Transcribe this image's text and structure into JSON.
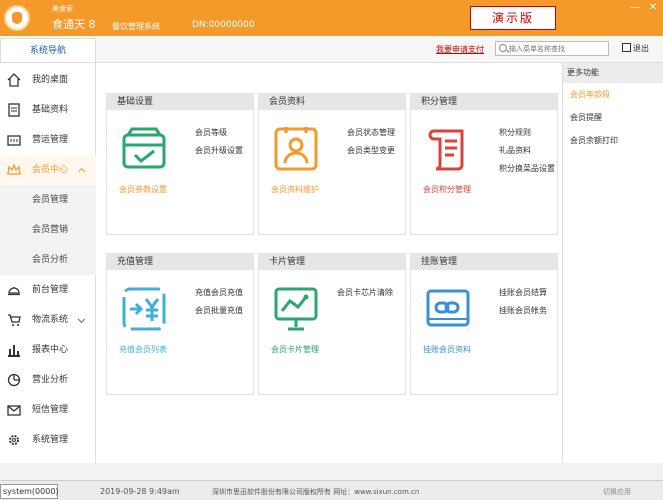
{
  "titlebar": {
    "brand_small": "美食家",
    "brand_big": "食通天 8",
    "system_name": "餐饮管理系统",
    "dn": "DN:00000000",
    "demo_badge": "演示版",
    "minimize": "—",
    "close": "✕"
  },
  "header": {
    "nav_title": "系统导航",
    "apply_link": "我要申请支付",
    "search_placeholder": "输入菜单名称查找",
    "exit_label": "退出"
  },
  "sidebar": {
    "items": [
      {
        "label": "我的桌面",
        "icon": "home-icon"
      },
      {
        "label": "基础资料",
        "icon": "document-icon"
      },
      {
        "label": "营运管理",
        "icon": "register-icon"
      },
      {
        "label": "会员中心",
        "icon": "crown-icon",
        "active": true
      },
      {
        "label": "前台管理",
        "icon": "cloche-icon"
      },
      {
        "label": "物流系统",
        "icon": "cart-icon"
      },
      {
        "label": "报表中心",
        "icon": "bar-chart-icon"
      },
      {
        "label": "营业分析",
        "icon": "pie-chart-icon"
      },
      {
        "label": "短信管理",
        "icon": "mail-icon"
      },
      {
        "label": "系统管理",
        "icon": "gear-icon"
      }
    ],
    "sub_items": [
      "会员管理",
      "会员营销",
      "会员分析"
    ]
  },
  "cards": [
    {
      "title": "基础设置",
      "links": [
        "会员等级",
        "会员升级设置"
      ],
      "footer": "会员参数设置",
      "color": "#2aa66f",
      "icon": "box-check-icon"
    },
    {
      "title": "会员资料",
      "links": [
        "会员状态管理",
        "会员类型变更"
      ],
      "footer": "会员资料维护",
      "color": "#f39a2a",
      "icon": "id-card-icon"
    },
    {
      "title": "积分管理",
      "links": [
        "积分规则",
        "礼品资料",
        "积分换菜品设置"
      ],
      "footer": "会员积分管理",
      "color": "#d9433a",
      "icon": "scroll-icon"
    },
    {
      "title": "充值管理",
      "links": [
        "充值会员充值",
        "会员批量充值"
      ],
      "footer": "充值会员列表",
      "color": "#3fb1d6",
      "icon": "yen-transfer-icon"
    },
    {
      "title": "卡片管理",
      "links": [
        "会员卡芯片清除"
      ],
      "footer": "会员卡片管理",
      "color": "#2aa66f",
      "icon": "screen-chart-icon"
    },
    {
      "title": "挂账管理",
      "links": [
        "挂账会员结算",
        "挂账会员帐务"
      ],
      "footer": "挂账会员资料",
      "color": "#3a8fd6",
      "icon": "link-card-icon"
    }
  ],
  "right_panel": {
    "title": "更多功能",
    "items": [
      "会员年龄段",
      "会员提醒",
      "会员余额打印"
    ]
  },
  "statusbar": {
    "user": "system(0000)",
    "time": "2019-09-28 9:49am",
    "copyright": "深圳市思迅软件股份有限公司版权所有 网址：www.sixun.com.cn",
    "right": "切换应用"
  }
}
